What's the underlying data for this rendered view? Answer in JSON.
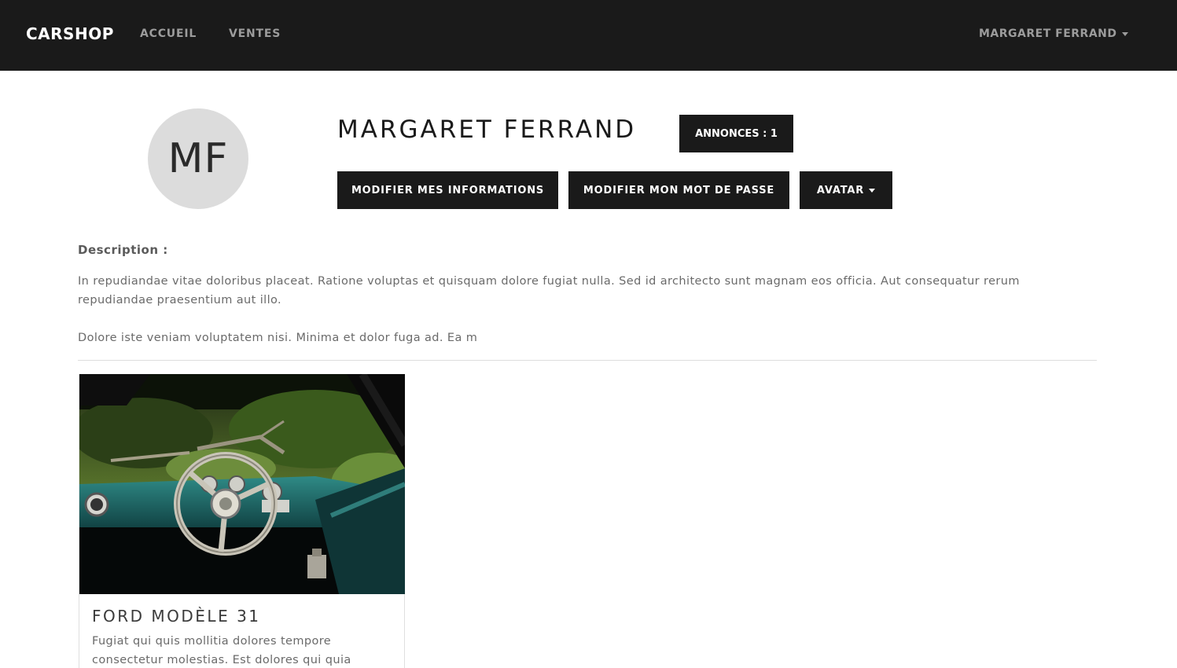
{
  "navbar": {
    "brand": "CARSHOP",
    "links": [
      {
        "label": "ACCUEIL"
      },
      {
        "label": "VENTES"
      }
    ],
    "user_menu": "MARGARET FERRAND"
  },
  "profile": {
    "initials": "MF",
    "name": "MARGARET FERRAND",
    "annonces_badge": "ANNONCES : 1",
    "buttons": {
      "edit_info": "MODIFIER MES INFORMATIONS",
      "edit_password": "MODIFIER MON MOT DE PASSE",
      "avatar": "AVATAR"
    }
  },
  "description": {
    "label": "Description :",
    "paragraph1": "In repudiandae vitae doloribus placeat. Ratione voluptas et quisquam dolore fugiat nulla. Sed id architecto sunt magnam eos officia. Aut consequatur rerum repudiandae praesentium aut illo.",
    "paragraph2": "Dolore iste veniam voluptatem nisi. Minima et dolor fuga ad. Ea m"
  },
  "listings": [
    {
      "title": "FORD MODÈLE 31",
      "excerpt": "Fugiat qui quis mollitia dolores tempore consectetur molestias. Est dolores qui quia"
    }
  ],
  "colors": {
    "navbar_bg": "#1a1a1a",
    "button_bg": "#1a1a1a",
    "avatar_bg": "#dcdcdc"
  }
}
